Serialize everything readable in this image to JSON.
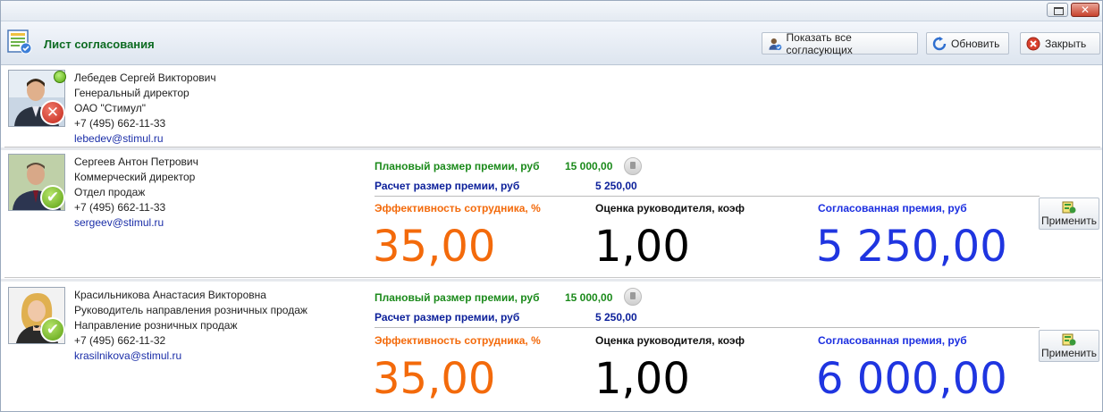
{
  "window": {
    "close_glyph": "✕"
  },
  "toolbar": {
    "title": "Лист согласования",
    "show_all_label": "Показать все согласующих",
    "refresh_label": "Обновить",
    "close_label": "Закрыть"
  },
  "rows": [
    {
      "name": "Лебедев Сергей Викторович",
      "position": "Генеральный директор",
      "department": "ОАО \"Стимул\"",
      "phone": "+7 (495) 662-11-33",
      "email": "lebedev@stimul.ru",
      "status": "rejected",
      "status_glyph": "✕"
    },
    {
      "name": "Сергеев Антон Петрович",
      "position": "Коммерческий директор",
      "department": "Отдел продаж",
      "phone": "+7 (495) 662-11-33",
      "email": "sergeev@stimul.ru",
      "status": "approved",
      "status_glyph": "✔",
      "planned_label": "Плановый размер премии, руб",
      "planned_value": "15 000,00",
      "calc_label": "Расчет размер премии, руб",
      "calc_value": "5 250,00",
      "eff_label": "Эффективность сотрудника, %",
      "coef_label": "Оценка руководителя, коэф",
      "agreed_label": "Согласованная премия, руб",
      "eff_value": "35,00",
      "coef_value": "1,00",
      "agreed_value": "5 250,00",
      "apply_label": "Применить"
    },
    {
      "name": "Красильникова Анастасия Викторовна",
      "position": "Руководитель направления розничных продаж",
      "department": "Направление розничных продаж",
      "phone": "+7 (495) 662-11-32",
      "email": "krasilnikova@stimul.ru",
      "status": "approved",
      "status_glyph": "✔",
      "planned_label": "Плановый размер премии, руб",
      "planned_value": "15 000,00",
      "calc_label": "Расчет размер премии, руб",
      "calc_value": "5 250,00",
      "eff_label": "Эффективность сотрудника, %",
      "coef_label": "Оценка руководителя, коэф",
      "agreed_label": "Согласованная премия, руб",
      "eff_value": "35,00",
      "coef_value": "1,00",
      "agreed_value": "6 000,00",
      "apply_label": "Применить"
    }
  ],
  "colors": {
    "title_green": "#0d6b22",
    "planned_green": "#1b8a1b",
    "calc_blue": "#0b1f9a",
    "efficiency_orange": "#f36a0b",
    "agreed_blue": "#1f35e0"
  },
  "icons": {
    "app": "approval-sheet-icon",
    "show_all": "users-approve-icon",
    "refresh": "refresh-icon",
    "close": "close-circle-icon",
    "apply": "apply-document-icon",
    "thumb": "thumbs-up-icon"
  }
}
